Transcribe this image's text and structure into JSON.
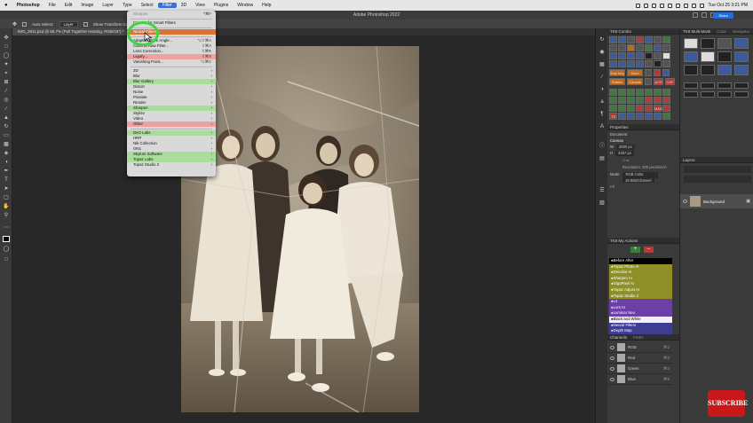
{
  "macbar": {
    "app": "Photoshop",
    "menus": [
      "File",
      "Edit",
      "Image",
      "Layer",
      "Type",
      "Select",
      "Filter",
      "3D",
      "View",
      "Plugins",
      "Window",
      "Help"
    ],
    "active_menu": "Filter",
    "clock": "Tue Oct 25  3:21 PM"
  },
  "titlebar": {
    "title": "Adobe Photoshop 2022",
    "share": "Share"
  },
  "options": {
    "auto_select": "Auto-Select:",
    "layer": "Layer",
    "transform": "Show Transform Controls"
  },
  "document_tab": {
    "label": "IMG_2811.psd @ 66.7% (Pull Together Heating, RGB/16*) *"
  },
  "filter_menu": {
    "items": [
      {
        "label": "Sharpen",
        "shortcut": "^⌘F",
        "style": "dim"
      },
      {
        "sep": true
      },
      {
        "label": "Convert for Smart Filters",
        "style": "normal"
      },
      {
        "sep": true
      },
      {
        "label": "Neural Filters...",
        "style": "orange"
      },
      {
        "sep": true
      },
      {
        "label": "Adaptive Wide Angle...",
        "shortcut": "⌥⇧⌘A",
        "style": "normal"
      },
      {
        "label": "Camera Raw Filter...",
        "shortcut": "⇧⌘A",
        "style": "normal"
      },
      {
        "label": "Lens Correction...",
        "shortcut": "⇧⌘R",
        "style": "normal"
      },
      {
        "label": "Liquify...",
        "shortcut": "⇧⌘X",
        "style": "pink"
      },
      {
        "label": "Vanishing Point...",
        "shortcut": "⌥⌘V",
        "style": "normal"
      },
      {
        "sep": true
      },
      {
        "label": "3D",
        "sub": true,
        "style": "normal"
      },
      {
        "label": "Blur",
        "sub": true,
        "style": "normal"
      },
      {
        "label": "Blur Gallery",
        "sub": true,
        "style": "green"
      },
      {
        "label": "Distort",
        "sub": true,
        "style": "normal"
      },
      {
        "label": "Noise",
        "sub": true,
        "style": "normal"
      },
      {
        "label": "Pixelate",
        "sub": true,
        "style": "normal"
      },
      {
        "label": "Render",
        "sub": true,
        "style": "normal"
      },
      {
        "label": "Sharpen",
        "sub": true,
        "style": "green"
      },
      {
        "label": "Stylize",
        "sub": true,
        "style": "normal"
      },
      {
        "label": "Video",
        "sub": true,
        "style": "normal"
      },
      {
        "label": "Other",
        "sub": true,
        "style": "pink"
      },
      {
        "sep": true
      },
      {
        "label": "DxO Labs",
        "sub": true,
        "style": "green"
      },
      {
        "label": "HRP",
        "sub": true,
        "style": "normal"
      },
      {
        "label": "Nik Collection",
        "sub": true,
        "style": "normal"
      },
      {
        "label": "ON1",
        "sub": true,
        "style": "normal"
      },
      {
        "label": "Skylum Software",
        "sub": true,
        "style": "green"
      },
      {
        "label": "Topaz Labs",
        "sub": true,
        "style": "green"
      },
      {
        "label": "Topaz Studio 2",
        "sub": true,
        "style": "normal"
      }
    ]
  },
  "tk_panel": {
    "tabs": [
      "TK8 Combo"
    ],
    "labels": {
      "dup_img": "Dup Img",
      "save": "Save",
      "flatten": "Flatten",
      "canvas": "Canvas",
      "acr": "ACR",
      "caf": "CAF",
      "mask": "MASK",
      "ts": "TS",
      "multi": "TK8 Multi-Mask",
      "color": "Color",
      "navigator": "Navigator"
    }
  },
  "properties": {
    "title": "Properties",
    "doc": "Document",
    "canvas": "Canvas",
    "w": "2000 px",
    "h": "3467 px",
    "resolution": "Resolution: 300 pixels/inch",
    "mode_label": "Mode",
    "mode": "RGB Color",
    "depth": "16 Bits/Channel",
    "fill": "Fill"
  },
  "layers": {
    "title": "Layers",
    "layer_name": "Background"
  },
  "actions": {
    "title": "TK8 My Actions",
    "items": [
      {
        "label": "●Before After",
        "bg": "#000000"
      },
      {
        "label": "●Topaz Photo AI",
        "bg": "#8f8f2a"
      },
      {
        "label": "●Denoise AI",
        "bg": "#8f8f2a"
      },
      {
        "label": "●Sharpen AI",
        "bg": "#8f8f2a"
      },
      {
        "label": "●GigaPixel AI",
        "bg": "#8f8f2a"
      },
      {
        "label": "●Topaz Adjust AI",
        "bg": "#8f8f2a"
      },
      {
        "label": "●Topaz Studio 2",
        "bg": "#8f8f2a"
      },
      {
        "label": "●L4",
        "bg": "#6b3fa6"
      },
      {
        "label": "●Lum AI",
        "bg": "#6b3fa6"
      },
      {
        "label": "●Luminar Neo",
        "bg": "#6b3fa6"
      },
      {
        "label": "●Black and White",
        "bg": "#f2f2f2",
        "fg": "#000000"
      },
      {
        "label": "●Neural Filters",
        "bg": "#3d3d94"
      },
      {
        "label": "●Depth Map",
        "bg": "#3d3d94"
      }
    ]
  },
  "channels": {
    "title": "Channels",
    "paths": "Paths",
    "items": [
      {
        "name": "RGB",
        "sc": "⌘2"
      },
      {
        "name": "Red",
        "sc": "⌘3"
      },
      {
        "name": "Green",
        "sc": "⌘4"
      },
      {
        "name": "Blue",
        "sc": "⌘5"
      }
    ]
  },
  "subscribe": "SUBSCRIBE",
  "colors": {
    "accent": "#3b6fd8",
    "neural": "#d9733a",
    "highlight_circle": "#3ed63e"
  }
}
